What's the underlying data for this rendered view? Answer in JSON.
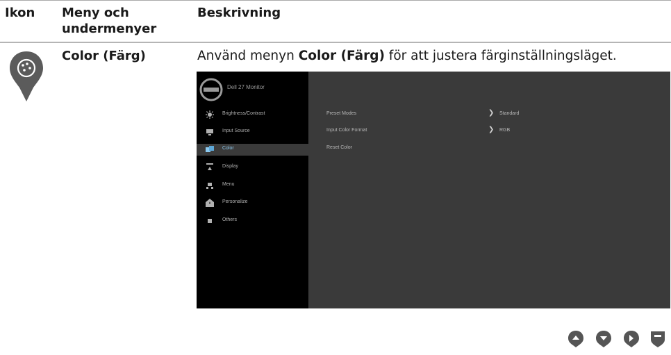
{
  "table": {
    "headers": {
      "icon": "Ikon",
      "menu": "Meny och undermenyer",
      "description": "Beskrivning"
    },
    "row": {
      "icon": "palette-icon",
      "name": "Color (Färg)",
      "desc_before": "Använd menyn ",
      "desc_bold": "Color (Färg)",
      "desc_after": " för att justera färginställningsläget."
    }
  },
  "osd": {
    "title": "Dell 27 Monitor",
    "menu": [
      {
        "label": "Brightness/Contrast",
        "icon": "sun-icon"
      },
      {
        "label": "Input Source",
        "icon": "input-icon"
      },
      {
        "label": "Color",
        "icon": "color-icon",
        "active": true
      },
      {
        "label": "Display",
        "icon": "display-icon"
      },
      {
        "label": "Menu",
        "icon": "menu-icon"
      },
      {
        "label": "Personalize",
        "icon": "star-icon"
      },
      {
        "label": "Others",
        "icon": "others-icon"
      }
    ],
    "submenu": [
      {
        "label": "Preset Modes",
        "value": "Standard"
      },
      {
        "label": "Input Color Format",
        "value": "RGB"
      },
      {
        "label": "Reset Color",
        "value": ""
      }
    ],
    "colors": {
      "active_bg": "#3a3a3a",
      "active_text": "#8cc9ef",
      "sidebar": "#000000"
    }
  },
  "buttons": [
    "up-button-icon",
    "down-button-icon",
    "right-button-icon",
    "back-button-icon"
  ]
}
